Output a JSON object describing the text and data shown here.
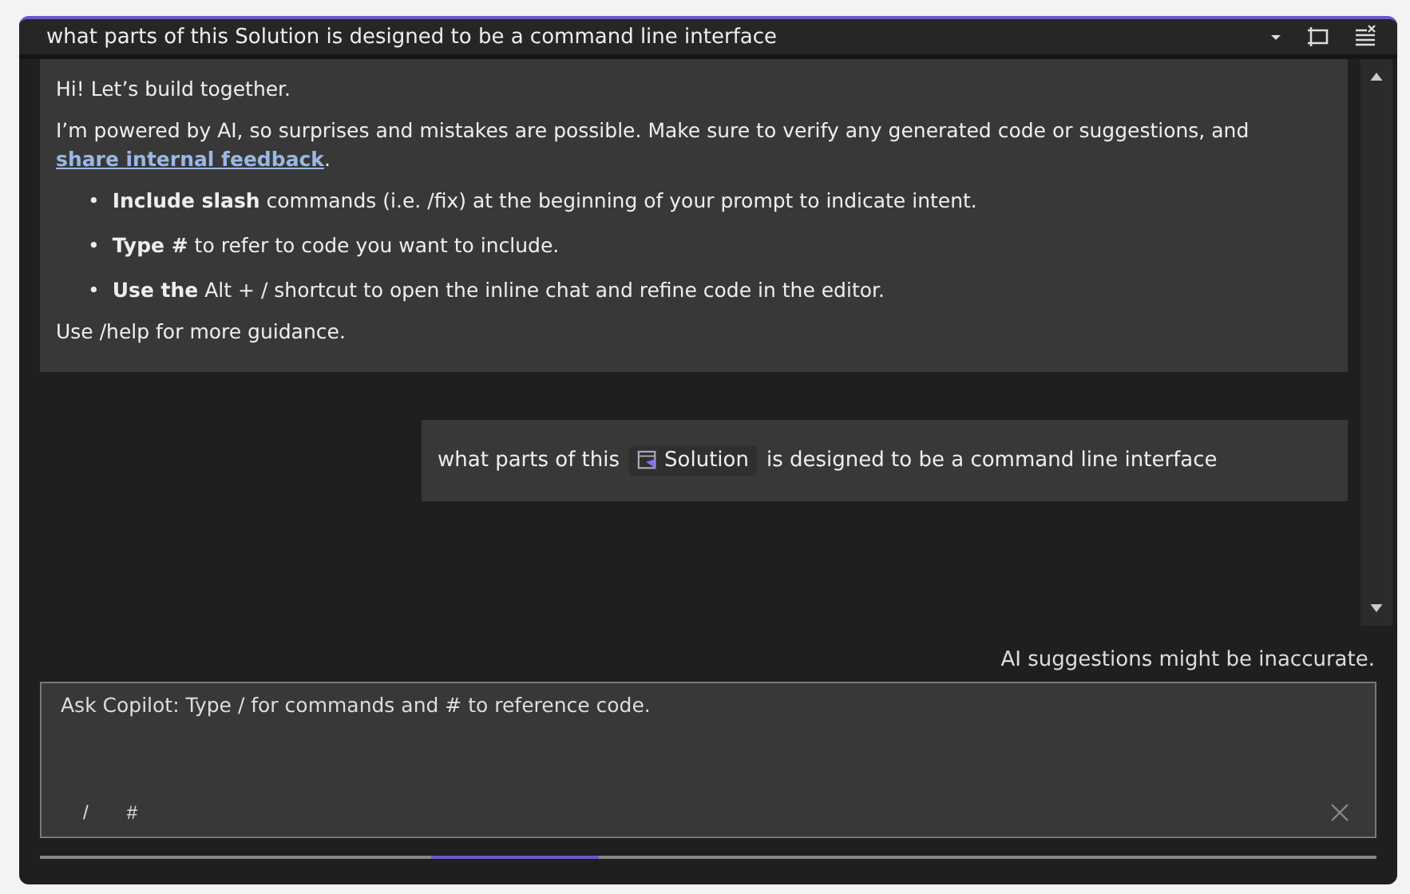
{
  "title_bar": {
    "title": "what parts of this Solution is designed to be a command line interface"
  },
  "welcome": {
    "greeting": "Hi! Let’s build together.",
    "notice": {
      "text": "I’m powered by AI, so surprises and mistakes are possible. Make sure to verify any generated code or suggestions, and",
      "link": "share internal feedback",
      "after": "."
    },
    "tips": [
      {
        "bullet": "•",
        "text": "**Include slash** commands (i.e. /fix) at the beginning of your prompt to indicate intent."
      },
      {
        "bullet": "•",
        "text": "**Type #** to refer to code you want to include."
      },
      {
        "bullet": "•",
        "text": "**Use the** Alt + / shortcut to open the inline chat and refine code in the editor."
      }
    ],
    "footer": "Use /help for more guidance."
  },
  "user_message": {
    "before": "what parts of this",
    "reference": "Solution",
    "after": "is designed to be a command line interface"
  },
  "disclaimer": "AI suggestions might be inaccurate.",
  "input": {
    "placeholder": "Ask Copilot: Type / for commands and # to reference code.",
    "commands": [
      "/",
      "#"
    ]
  }
}
